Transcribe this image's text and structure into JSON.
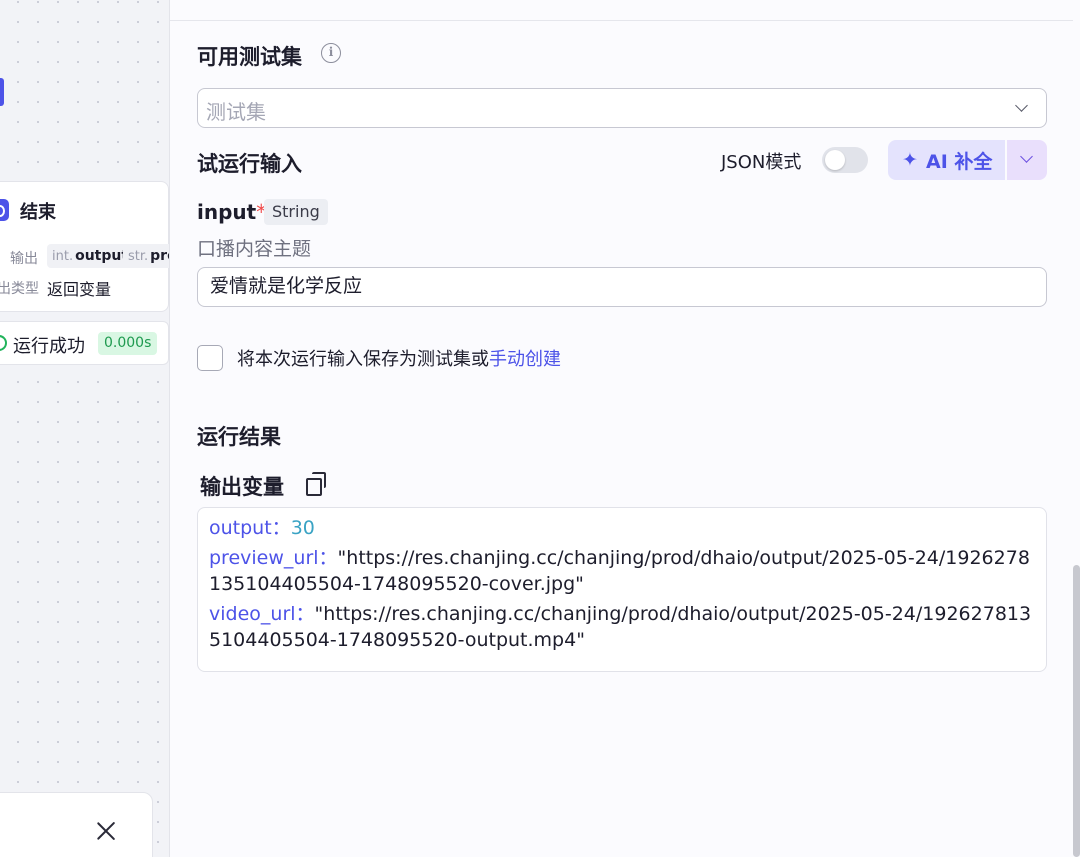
{
  "canvas": {
    "end_node": {
      "title": "结束",
      "output_label": "输出",
      "output_tags": [
        {
          "type": "int.",
          "name": "output"
        },
        {
          "type": "str.",
          "name": "pre"
        }
      ],
      "output_type_label": "出类型",
      "output_type_value": "返回变量"
    },
    "run_status": {
      "text": "运行成功",
      "time": "0.000s"
    }
  },
  "panel": {
    "testset": {
      "title": "可用测试集",
      "info_icon": "i",
      "placeholder": "测试集"
    },
    "trial_input": {
      "title": "试运行输入",
      "json_mode_label": "JSON模式",
      "json_mode_on": false,
      "ai_button": {
        "icon": "✦",
        "label": "AI 补全"
      }
    },
    "field": {
      "name": "input",
      "required_mark": "*",
      "type": "String",
      "description": "口播内容主题",
      "value": "爱情就是化学反应"
    },
    "save_option": {
      "text": "将本次运行输入保存为测试集或",
      "link": "手动创建",
      "checked": false
    },
    "run_result": {
      "title": "运行结果",
      "output_vars_title": "输出变量",
      "outputs": [
        {
          "key": "output",
          "sep": "：",
          "value": "30"
        },
        {
          "key": "preview_url",
          "sep": "：",
          "value": "\"https://res.chanjing.cc/chanjing/prod/dhaio/output/2025-05-24/1926278135104405504-1748095520-cover.jpg\""
        },
        {
          "key": "video_url",
          "sep": "：",
          "value": "\"https://res.chanjing.cc/chanjing/prod/dhaio/output/2025-05-24/1926278135104405504-1748095520-output.mp4\""
        }
      ]
    }
  },
  "colors": {
    "accent": "#4d53e8",
    "success": "#21b35b",
    "required": "#f04a4a"
  }
}
